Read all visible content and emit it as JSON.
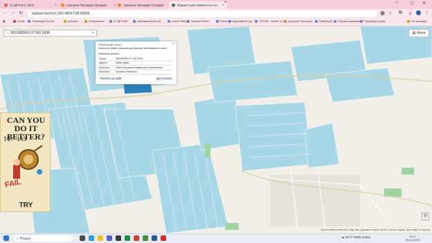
{
  "browser": {
    "tabs": [
      {
        "label": "ІС ДЕТНАС 2576"
      },
      {
        "label": "Аукціони Прозорро Продажі"
      },
      {
        "label": "Аукціони Прозорро Продажі"
      },
      {
        "label": "Відкриті дані земельного ка"
      }
    ],
    "url": "kadastr.live/#14.2/50.48557/28.46836",
    "bookmarks": [
      "Gmail",
      "Переведіть ботки",
      "реєстри",
      "нотаріальна",
      "ІС ДЕТНАС",
      "Державний реєстр",
      "Аннон Watch",
      "Аграрні бізнес",
      "Баланс",
      "Державний суд",
      "СЕТАМ - зелені чи",
      "Аукціони Прозорро",
      "Публікації",
      "Переказ документ",
      "Переведіть роки"
    ],
    "all_bookmarks": "Усі закладки"
  },
  "map": {
    "search_value": "5621083900 07 002 0038",
    "layers_label": "Фоон",
    "zoom_in": "+",
    "zoom_out": "−",
    "attribution": "OpenStreetMap contributors | Map data | Державна служба України з питань геодезії, картографії та кадастру"
  },
  "popup": {
    "header_line1": "Об'єкти в цій точці: 1",
    "header_line2": "Натисніть праве клацання для фіксації вспливаючого вікна",
    "section": "Земельна ділянка",
    "rows": [
      {
        "k": "Номер",
        "v": "5621083900 07 002 0038"
      },
      {
        "k": "Адреса",
        "v": "немає даних"
      },
      {
        "k": "Категорія",
        "v": "Землі сільськогосподарського призначення"
      },
      {
        "k": "Власність",
        "v": "Приватна власність"
      }
    ],
    "link_left": "Перейти до ДЗК",
    "link_right": "Детальніше"
  },
  "ad": {
    "headline": "CAN YOU DO IT BETTER?",
    "iq": "IQ: 155",
    "fail": "FAIL",
    "cta": "TRY"
  },
  "taskbar": {
    "search_placeholder": "Пошук",
    "weather": "16°C Partly sunny",
    "time": "15:47",
    "date": "05.04.2023"
  },
  "colors": {
    "parcel": "#a9d7e5",
    "parcel_stroke": "#ffffff",
    "highlight": "#2d7fb8",
    "tab_bg": "#f6cdd9"
  }
}
